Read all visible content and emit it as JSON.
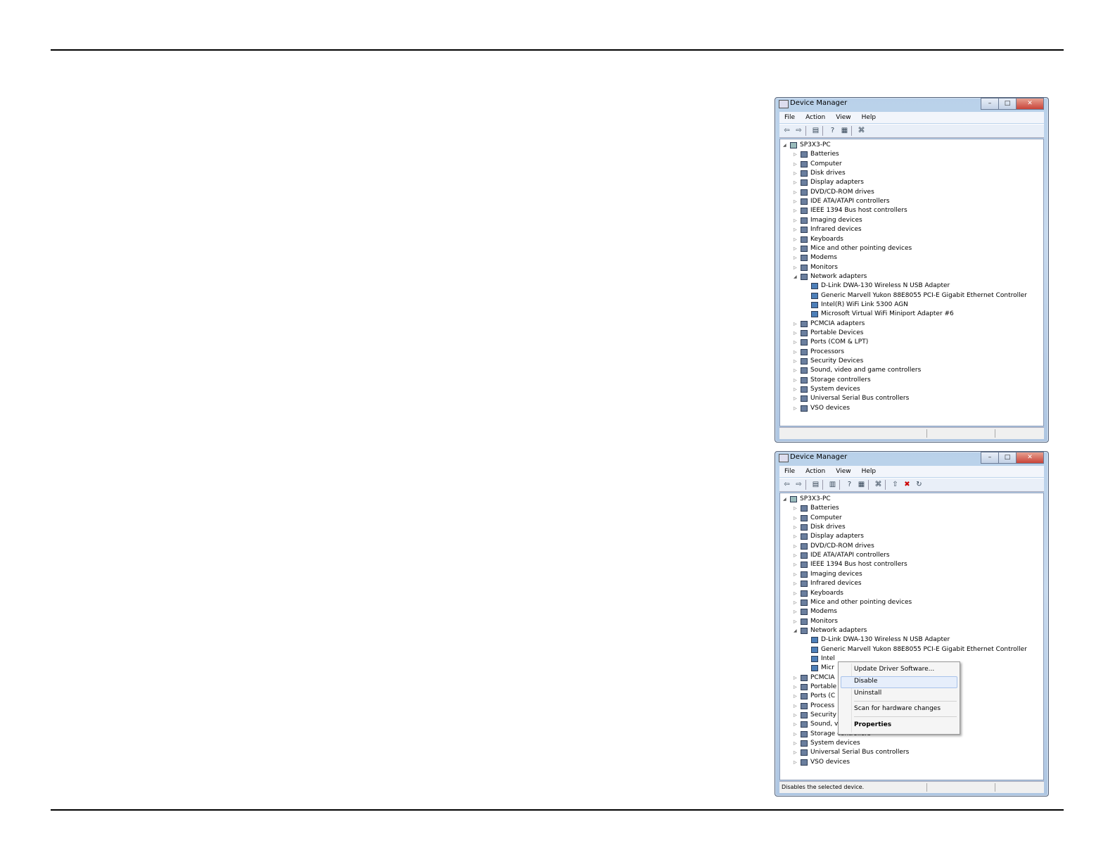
{
  "page": {},
  "window1": {
    "title": "Device Manager",
    "menu": [
      "File",
      "Action",
      "View",
      "Help"
    ],
    "root": "SP3X3-PC",
    "categories": [
      "Batteries",
      "Computer",
      "Disk drives",
      "Display adapters",
      "DVD/CD-ROM drives",
      "IDE ATA/ATAPI controllers",
      "IEEE 1394 Bus host controllers",
      "Imaging devices",
      "Infrared devices",
      "Keyboards",
      "Mice and other pointing devices",
      "Modems",
      "Monitors",
      "Network adapters"
    ],
    "network_children": [
      "D-Link DWA-130 Wireless N USB Adapter",
      "Generic Marvell Yukon 88E8055 PCI-E Gigabit Ethernet Controller",
      "Intel(R) WiFi Link 5300 AGN",
      "Microsoft Virtual WiFi Miniport Adapter #6"
    ],
    "categories_after": [
      "PCMCIA adapters",
      "Portable Devices",
      "Ports (COM & LPT)",
      "Processors",
      "Security Devices",
      "Sound, video and game controllers",
      "Storage controllers",
      "System devices",
      "Universal Serial Bus controllers",
      "VSO devices"
    ],
    "status": ""
  },
  "window2": {
    "title": "Device Manager",
    "menu": [
      "File",
      "Action",
      "View",
      "Help"
    ],
    "root": "SP3X3-PC",
    "categories": [
      "Batteries",
      "Computer",
      "Disk drives",
      "Display adapters",
      "DVD/CD-ROM drives",
      "IDE ATA/ATAPI controllers",
      "IEEE 1394 Bus host controllers",
      "Imaging devices",
      "Infrared devices",
      "Keyboards",
      "Mice and other pointing devices",
      "Modems",
      "Monitors",
      "Network adapters"
    ],
    "network_children": [
      "D-Link DWA-130 Wireless N USB Adapter",
      "Generic Marvell Yukon 88E8055 PCI-E Gigabit Ethernet Controller",
      "Intel",
      "Micr"
    ],
    "categories_after": [
      "PCMCIA",
      "Portable",
      "Ports (C",
      "Process",
      "Security",
      "Sound, video and game controllers",
      "Storage controllers",
      "System devices",
      "Universal Serial Bus controllers",
      "VSO devices"
    ],
    "status": "Disables the selected device.",
    "context_menu": {
      "items": [
        "Update Driver Software...",
        "Disable",
        "Uninstall",
        "Scan for hardware changes",
        "Properties"
      ],
      "highlighted": "Disable"
    }
  }
}
